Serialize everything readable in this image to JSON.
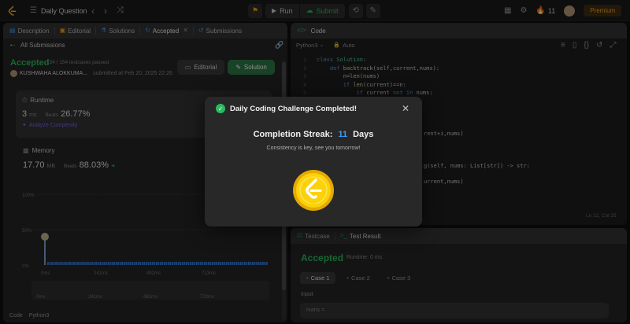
{
  "topbar": {
    "title": "Daily Question",
    "run_label": "Run",
    "submit_label": "Submit",
    "streak_count": "11",
    "premium_label": "Premium"
  },
  "left_tabs": [
    "Description",
    "Editorial",
    "Solutions",
    "Accepted",
    "Submissions"
  ],
  "submission": {
    "back_label": "All Submissions",
    "status": "Accepted",
    "testcases": "154 / 154 testcases passed",
    "user": "KUSHWAHA ALOKKUMA...",
    "submitted": "submitted at Feb 20, 2025 22:26",
    "editorial_btn": "Editorial",
    "solution_btn": "Solution",
    "runtime_title": "Runtime",
    "runtime_value": "3",
    "runtime_unit": "ms",
    "beats_label": "Beats",
    "runtime_beats": "26.77%",
    "analyze_label": "Analyze Complexity",
    "memory_title": "Memory",
    "memory_value": "17.70",
    "memory_unit": "MB",
    "memory_beats": "88.03%",
    "code_label": "Code",
    "lang_label": "Python3"
  },
  "chart_data": {
    "type": "bar",
    "ytick_labels": [
      "100%",
      "50%",
      "0%"
    ],
    "xtick_labels": [
      "0ms",
      "241ms",
      "482ms",
      "723ms"
    ],
    "scroll_tick_labels": [
      "0ms",
      "241ms",
      "482ms",
      "723ms"
    ]
  },
  "code_panel": {
    "title": "Code",
    "language": "Python3",
    "autosave": "Auto",
    "cursor_pos": "Ln 12, Col 25",
    "lines": [
      {
        "n": "1",
        "text": "class Solution:"
      },
      {
        "n": "2",
        "text": "    def backtrack(self,current,nums):"
      },
      {
        "n": "3",
        "text": "        n=len(nums)"
      },
      {
        "n": "4",
        "text": "        if len(current)==n:"
      },
      {
        "n": "5",
        "text": "            if current not in nums:"
      }
    ],
    "frag_right": [
      {
        "text": "rent+i,nums)"
      },
      {
        "text": "g(self, nums: List[str]) -> str:"
      },
      {
        "text": "urrent,nums)"
      }
    ]
  },
  "bottom_panel": {
    "tab_testcase": "Testcase",
    "tab_result": "Test Result",
    "status": "Accepted",
    "runtime": "Runtime: 0 ms",
    "cases": [
      "Case 1",
      "Case 2",
      "Case 3"
    ],
    "input_label": "Input",
    "input_value": "nums ="
  },
  "modal": {
    "header": "Daily Coding Challenge Completed!",
    "streak_prefix": "Completion Streak:",
    "streak_count": "11",
    "streak_suffix": "Days",
    "subtitle": "Consistency is key, see you tomorrow!"
  },
  "colors": {
    "accent_green": "#2cbb5d",
    "streak_blue": "#3b9ef5",
    "coin_gold": "#fbd20a",
    "premium_orange": "#ffa116"
  }
}
